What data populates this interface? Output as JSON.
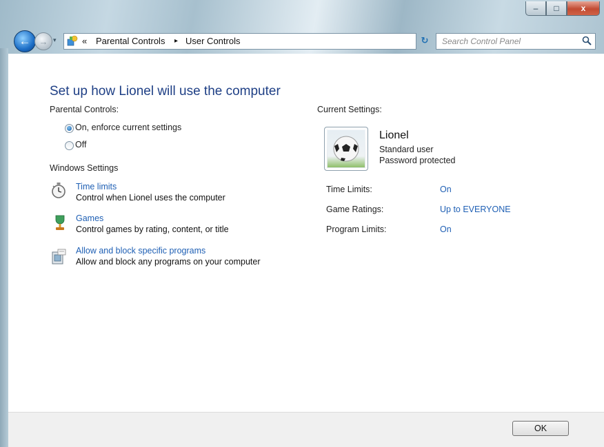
{
  "window": {
    "minimize_glyph": "–",
    "maximize_glyph": "□",
    "close_glyph": "x"
  },
  "nav": {
    "back_glyph": "←",
    "forward_glyph": "→",
    "history_dropdown_glyph": "▾",
    "crumb_overflow": "«",
    "breadcrumb": [
      "Parental Controls",
      "User Controls"
    ],
    "crumb_separator": "▸",
    "address_dropdown_glyph": "▾",
    "refresh_glyph": "↻",
    "search_placeholder": "Search Control Panel"
  },
  "help_glyph": "?",
  "page": {
    "title": "Set up how Lionel will use the computer",
    "parental_controls_label": "Parental Controls:",
    "options": [
      {
        "label": "On, enforce current settings",
        "selected": true
      },
      {
        "label": "Off",
        "selected": false
      }
    ],
    "windows_settings_label": "Windows Settings",
    "settings": [
      {
        "icon": "stopwatch-icon",
        "link": "Time limits",
        "description": "Control when Lionel uses the computer"
      },
      {
        "icon": "trophy-icon",
        "link": "Games",
        "description": "Control games by rating, content, or title"
      },
      {
        "icon": "program-icon",
        "link": "Allow and block specific programs",
        "description": "Allow and block any programs on your computer"
      }
    ]
  },
  "current": {
    "label": "Current Settings:",
    "user_name": "Lionel",
    "user_type": "Standard user",
    "password_status": "Password protected",
    "rows": [
      {
        "label": "Time Limits:",
        "value": "On"
      },
      {
        "label": "Game Ratings:",
        "value": "Up to EVERYONE"
      },
      {
        "label": "Program Limits:",
        "value": "On"
      }
    ]
  },
  "footer": {
    "ok_label": "OK"
  },
  "colors": {
    "heading": "#1e3f85",
    "link": "#1e5fb4"
  }
}
